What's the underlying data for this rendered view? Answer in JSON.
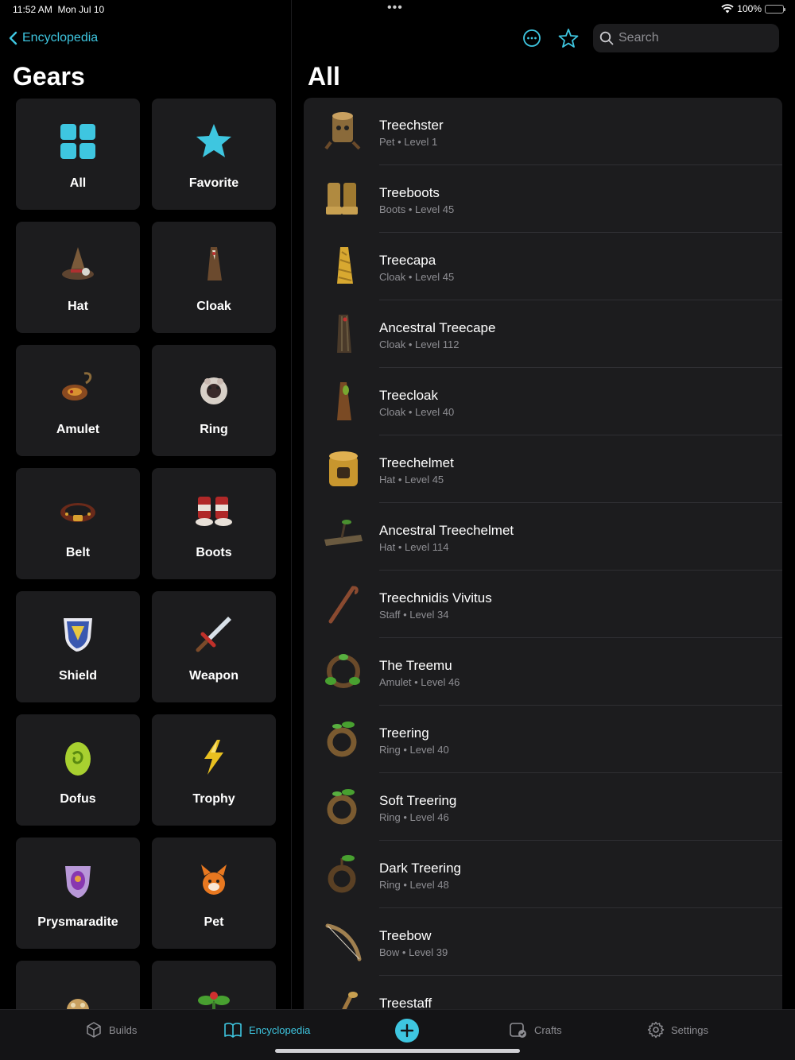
{
  "status": {
    "time": "11:52 AM",
    "date": "Mon Jul 10",
    "battery": "100%",
    "battery_level": 1.0,
    "dots": "•••"
  },
  "nav": {
    "back_label": "Encyclopedia"
  },
  "left": {
    "title": "Gears",
    "categories": [
      {
        "label": "All",
        "icon": "grid-icon"
      },
      {
        "label": "Favorite",
        "icon": "star-icon"
      },
      {
        "label": "Hat",
        "icon": "hat-icon"
      },
      {
        "label": "Cloak",
        "icon": "cloak-icon"
      },
      {
        "label": "Amulet",
        "icon": "amulet-icon"
      },
      {
        "label": "Ring",
        "icon": "ring-icon"
      },
      {
        "label": "Belt",
        "icon": "belt-icon"
      },
      {
        "label": "Boots",
        "icon": "boots-icon"
      },
      {
        "label": "Shield",
        "icon": "shield-icon"
      },
      {
        "label": "Weapon",
        "icon": "sword-icon"
      },
      {
        "label": "Dofus",
        "icon": "egg-icon"
      },
      {
        "label": "Trophy",
        "icon": "trophy-icon"
      },
      {
        "label": "Prysmaradite",
        "icon": "gem-shield-icon"
      },
      {
        "label": "Pet",
        "icon": "pet-icon"
      },
      {
        "label": "",
        "icon": "mount-icon"
      },
      {
        "label": "",
        "icon": "plant-icon"
      }
    ]
  },
  "right": {
    "title": "All",
    "search_placeholder": "Search",
    "items": [
      {
        "name": "Treechster",
        "type": "Pet",
        "level": "Level 1",
        "icon": "stump-icon"
      },
      {
        "name": "Treeboots",
        "type": "Boots",
        "level": "Level 45",
        "icon": "boots-icon"
      },
      {
        "name": "Treecapa",
        "type": "Cloak",
        "level": "Level 45",
        "icon": "leaf-cloak-icon"
      },
      {
        "name": "Ancestral Treecape",
        "type": "Cloak",
        "level": "Level 112",
        "icon": "bark-cloak-icon"
      },
      {
        "name": "Treecloak",
        "type": "Cloak",
        "level": "Level 40",
        "icon": "cloak-icon"
      },
      {
        "name": "Treechelmet",
        "type": "Hat",
        "level": "Level 45",
        "icon": "stump-helmet-icon"
      },
      {
        "name": "Ancestral Treechelmet",
        "type": "Hat",
        "level": "Level 114",
        "icon": "wood-hat-icon"
      },
      {
        "name": "Treechnidis Vivitus",
        "type": "Staff",
        "level": "Level 34",
        "icon": "staff-icon"
      },
      {
        "name": "The Treemu",
        "type": "Amulet",
        "level": "Level 46",
        "icon": "vine-amulet-icon"
      },
      {
        "name": "Treering",
        "type": "Ring",
        "level": "Level 40",
        "icon": "ring-icon"
      },
      {
        "name": "Soft Treering",
        "type": "Ring",
        "level": "Level 46",
        "icon": "ring-icon"
      },
      {
        "name": "Dark Treering",
        "type": "Ring",
        "level": "Level 48",
        "icon": "ring-icon"
      },
      {
        "name": "Treebow",
        "type": "Bow",
        "level": "Level 39",
        "icon": "bow-icon"
      },
      {
        "name": "Treestaff",
        "type": "",
        "level": "",
        "icon": "staff-icon"
      }
    ]
  },
  "tabs": [
    {
      "label": "Builds",
      "icon": "cube-icon"
    },
    {
      "label": "Encyclopedia",
      "icon": "book-icon"
    },
    {
      "label": "Crafts",
      "icon": "crafts-icon"
    },
    {
      "label": "Settings",
      "icon": "gear-icon"
    }
  ],
  "colors": {
    "accent": "#3ec6e0",
    "tile": "#1c1c1e",
    "secondary_text": "#8e8e93"
  }
}
